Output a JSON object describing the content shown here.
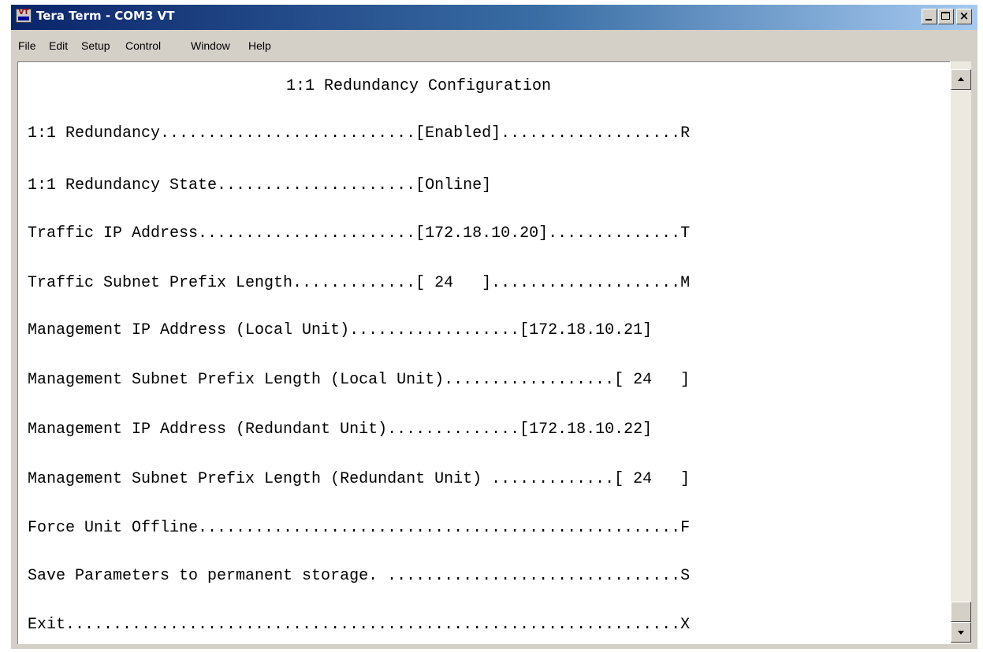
{
  "window": {
    "title": "Tera Term - COM3 VT",
    "icon": "teraterm-vt-icon",
    "controls": {
      "minimize_icon": "minimize-icon",
      "maximize_icon": "maximize-icon",
      "close_icon": "close-icon",
      "close_glyph": "×"
    }
  },
  "menu": [
    "File",
    "Edit",
    "Setup",
    "Control",
    "Window",
    "Help"
  ],
  "terminal": {
    "heading": "1:1 Redundancy Configuration",
    "lines": [
      "1:1 Redundancy...........................[Enabled]...................R",
      "1:1 Redundancy State.....................[Online]",
      "Traffic IP Address.......................[172.18.10.20]..............T",
      "Traffic Subnet Prefix Length.............[ 24   ]....................M",
      "Management IP Address (Local Unit)..................[172.18.10.21]",
      "Management Subnet Prefix Length (Local Unit)..................[ 24   ]",
      "Management IP Address (Redundant Unit)..............[172.18.10.22]",
      "Management Subnet Prefix Length (Redundant Unit) .............[ 24   ]",
      "Force Unit Offline...................................................F",
      "Save Parameters to permanent storage. ...............................S",
      "Exit.................................................................X"
    ]
  },
  "scrollbar": {
    "up_icon": "scroll-up-arrow-icon",
    "down_icon": "scroll-down-arrow-icon"
  },
  "colors": {
    "titlebar_start": "#0a246a",
    "titlebar_end": "#a6caf0",
    "chrome": "#d4d0c8",
    "terminal_bg": "#ffffff",
    "terminal_fg": "#000000"
  }
}
